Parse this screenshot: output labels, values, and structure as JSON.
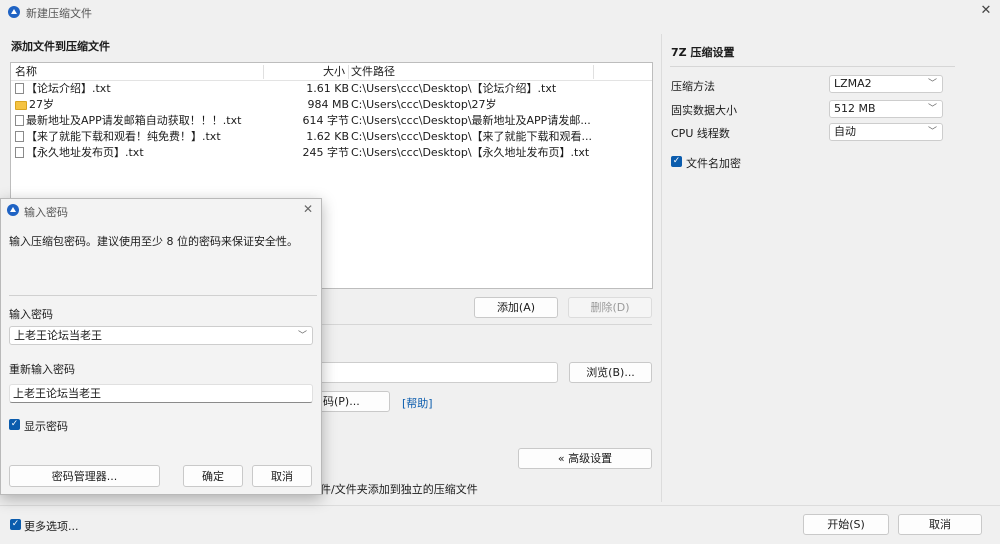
{
  "window": {
    "title": "新建压缩文件"
  },
  "main": {
    "section_title": "添加文件到压缩文件"
  },
  "file_list": {
    "columns": {
      "name": "名称",
      "size": "大小",
      "path": "文件路径"
    },
    "rows": [
      {
        "name": "【论坛介绍】.txt",
        "size": "1.61 KB",
        "path": "C:\\Users\\ccc\\Desktop\\【论坛介绍】.txt",
        "icon": "text-file-icon"
      },
      {
        "name": "27岁",
        "size": "984 MB",
        "path": "C:\\Users\\ccc\\Desktop\\27岁",
        "icon": "folder-icon"
      },
      {
        "name": "最新地址及APP请发邮箱自动获取！！！.txt",
        "size": "614 字节",
        "path": "C:\\Users\\ccc\\Desktop\\最新地址及APP请发邮...",
        "icon": "text-file-icon"
      },
      {
        "name": "【来了就能下载和观看！纯免费！】.txt",
        "size": "1.62 KB",
        "path": "C:\\Users\\ccc\\Desktop\\【来了就能下载和观看...",
        "icon": "text-file-icon"
      },
      {
        "name": "【永久地址发布页】.txt",
        "size": "245 字节",
        "path": "C:\\Users\\ccc\\Desktop\\【永久地址发布页】.txt",
        "icon": "text-file-icon"
      }
    ]
  },
  "buttons": {
    "add": "添加(A)",
    "delete": "删除(D)",
    "browse": "浏览(B)...",
    "password_partial": "码(P)...",
    "help": "[帮助]",
    "advanced": "« 高级设置",
    "start": "开始(S)",
    "cancel": "取消"
  },
  "partial_text": {
    "separate_archive": "件/文件夹添加到独立的压缩文件"
  },
  "more_options": {
    "label": "更多选项...",
    "checked": true
  },
  "settings_7z": {
    "title": "7Z 压缩设置",
    "method_label": "压缩方法",
    "method_value": "LZMA2",
    "dict_label": "固实数据大小",
    "dict_value": "512 MB",
    "threads_label": "CPU 线程数",
    "threads_value": "自动",
    "encrypt_names_label": "文件名加密",
    "encrypt_names_checked": true
  },
  "password_dialog": {
    "title": "输入密码",
    "description": "输入压缩包密码。建议使用至少 8 位的密码来保证安全性。",
    "enter_label": "输入密码",
    "enter_value": "上老王论坛当老王",
    "reenter_label": "重新输入密码",
    "reenter_value": "上老王论坛当老王",
    "show_password_label": "显示密码",
    "show_password_checked": true,
    "manager_button": "密码管理器...",
    "ok_button": "确定",
    "cancel_button": "取消"
  },
  "colors": {
    "accent": "#0b5cad",
    "link": "#0b5cad",
    "bg": "#f0f0f0"
  }
}
